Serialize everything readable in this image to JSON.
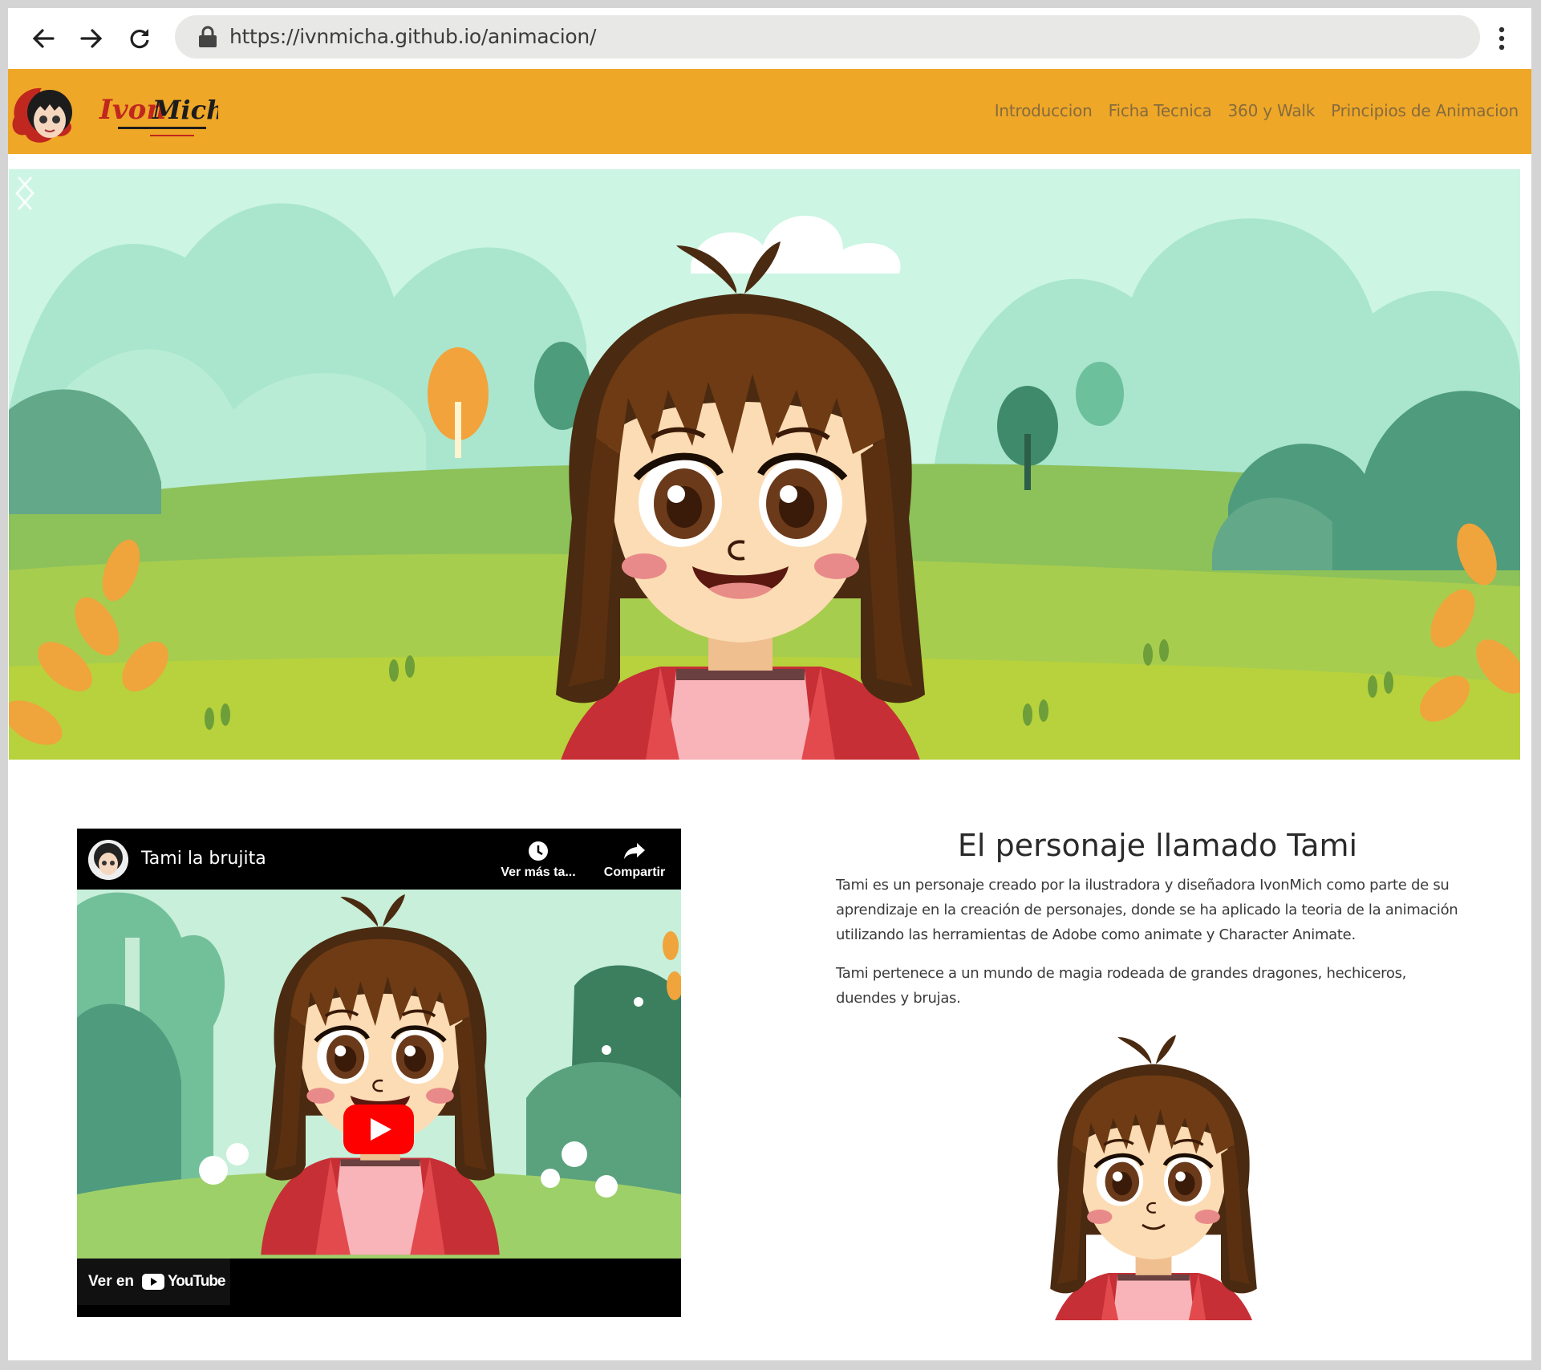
{
  "browser": {
    "url": "https://ivnmicha.github.io/animacion/",
    "icons": [
      "back-arrow-icon",
      "forward-arrow-icon",
      "reload-icon",
      "lock-icon",
      "more-vert-icon"
    ]
  },
  "header": {
    "bg_color": "#efa727",
    "logo_text": "Ivon Mich",
    "nav": [
      "Introduccion",
      "Ficha Tecnica",
      "360 y Walk",
      "Principios de Animacion"
    ]
  },
  "hero": {
    "prev_icon": "chevron-left-icon",
    "next_icon": "chevron-right-icon"
  },
  "video": {
    "title": "Tami la brujita",
    "watch_later": "Ver más ta...",
    "share": "Compartir",
    "watch_on": "Ver en",
    "youtube": "YouTube"
  },
  "content": {
    "title": "El personaje llamado Tami",
    "paragraph1": "Tami es un personaje creado por la ilustradora y diseñadora IvonMich como parte de su aprendizaje en la creación de personajes, donde se ha aplicado la teoria de la animación utilizando las herramientas de Adobe como animate y Character Animate.",
    "paragraph2": "Tami pertenece a un mundo de magia rodeada de grandes dragones, hechiceros, duendes y brujas."
  }
}
